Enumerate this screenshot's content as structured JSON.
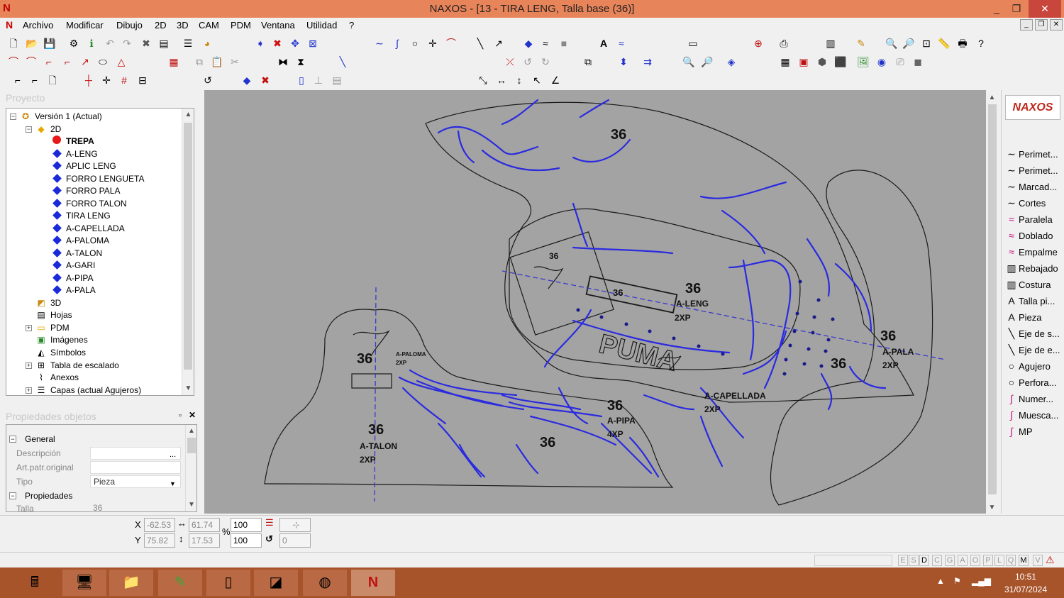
{
  "titlebar": {
    "title": "NAXOS - [13 - TIRA LENG, Talla base (36)]",
    "min": "_",
    "max": "❐",
    "close": "✕"
  },
  "menu": [
    "Archivo",
    "Modificar",
    "Dibujo",
    "2D",
    "3D",
    "CAM",
    "PDM",
    "Ventana",
    "Utilidad",
    "?"
  ],
  "panels": {
    "project": "Proyecto",
    "properties": "Propiedades objetos"
  },
  "tree": {
    "root": "Versión 1 (Actual)",
    "node_2d": "2D",
    "pieces": [
      "TREPA",
      "A-LENG",
      "APLIC LENG",
      "FORRO LENGUETA",
      "FORRO PALA",
      "FORRO TALON",
      "TIRA LENG",
      "A-CAPELLADA",
      "A-PALOMA",
      "A-TALON",
      "A-GARI",
      "A-PIPA",
      "A-PALA"
    ],
    "others": [
      "3D",
      "Hojas",
      "PDM",
      "Imágenes",
      "Símbolos",
      "Tabla de escalado",
      "Anexos",
      "Capas (actual Agujeros)"
    ]
  },
  "properties": {
    "sec_general": "General",
    "descripcion_label": "Descripción",
    "descripcion_btn": "...",
    "artpatr_label": "Art.patr.original",
    "tipo_label": "Tipo",
    "tipo_value": "Pieza",
    "sec_propiedades": "Propiedades",
    "talla_label": "Talla",
    "talla_value": "36"
  },
  "canvas": {
    "size_labels": [
      "36",
      "36",
      "36",
      "36",
      "36",
      "36",
      "36",
      "36",
      "36",
      "36",
      "36"
    ],
    "piece_labels": {
      "leng": "A-LENG",
      "leng_qty": "2XP",
      "pala": "A-PALA",
      "pala_qty": "2XP",
      "capellada": "A-CAPELLADA",
      "capellada_qty": "2XP",
      "pipa": "A-PIPA",
      "pipa_qty": "4XP",
      "talon": "A-TALON",
      "talon_qty": "2XP",
      "paloma": "A-PALOMA",
      "paloma_qty": "2XP"
    },
    "brand_text": "PUMA"
  },
  "right_panel": {
    "logo": "NAXOS",
    "tools": [
      {
        "icon": "∼",
        "label": "Perimet..."
      },
      {
        "icon": "∼",
        "label": "Perimet..."
      },
      {
        "icon": "∼",
        "label": "Marcad..."
      },
      {
        "icon": "∼",
        "label": "Cortes"
      },
      {
        "icon": "≈",
        "label": "Paralela"
      },
      {
        "icon": "≈",
        "label": "Doblado"
      },
      {
        "icon": "≈",
        "label": "Empalme"
      },
      {
        "icon": "▥",
        "label": "Rebajado"
      },
      {
        "icon": "▥",
        "label": "Costura"
      },
      {
        "icon": "A",
        "label": "Talla pi..."
      },
      {
        "icon": "A",
        "label": "Pieza"
      },
      {
        "icon": "╲",
        "label": "Eje de s..."
      },
      {
        "icon": "╲",
        "label": "Eje de e..."
      },
      {
        "icon": "○",
        "label": "Agujero"
      },
      {
        "icon": "○",
        "label": "Perfora..."
      },
      {
        "icon": "∫",
        "label": "Numer..."
      },
      {
        "icon": "∫",
        "label": "Muesca..."
      },
      {
        "icon": "∫",
        "label": "MP"
      }
    ]
  },
  "coords": {
    "x_label": "X",
    "y_label": "Y",
    "x": "-62.53",
    "y": "75.82",
    "w": "61.74",
    "h": "17.53",
    "pct": "%",
    "sx": "100",
    "sy": "100",
    "rot": "0"
  },
  "status_letters": [
    "E",
    "S",
    "D",
    "C",
    "G",
    "A",
    "O",
    "P",
    "L",
    "Q",
    "M",
    "V"
  ],
  "taskbar": {
    "time": "10:51",
    "date": "31/07/2024"
  }
}
